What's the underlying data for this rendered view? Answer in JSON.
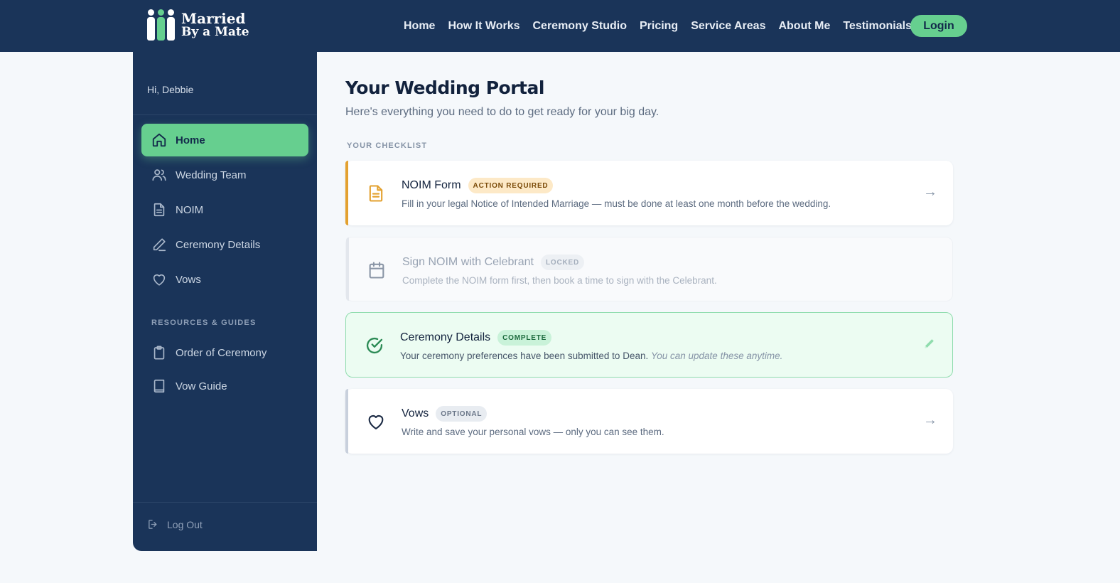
{
  "brand": {
    "line1": "Married",
    "line2": "By a Mate"
  },
  "nav": {
    "links": [
      "Home",
      "How It Works",
      "Ceremony Studio",
      "Pricing",
      "Service Areas",
      "About Me",
      "Testimonials"
    ],
    "login": "Login"
  },
  "sidebar": {
    "greeting": "Hi, Debbie",
    "items": [
      {
        "label": "Home",
        "icon": "home-icon"
      },
      {
        "label": "Wedding Team",
        "icon": "users-icon"
      },
      {
        "label": "NOIM",
        "icon": "document-icon"
      },
      {
        "label": "Ceremony Details",
        "icon": "pen-icon"
      },
      {
        "label": "Vows",
        "icon": "heart-icon"
      }
    ],
    "section_label": "RESOURCES & GUIDES",
    "resources": [
      {
        "label": "Order of Ceremony",
        "icon": "clipboard-icon"
      },
      {
        "label": "Vow Guide",
        "icon": "book-icon"
      }
    ],
    "logout": "Log Out"
  },
  "main": {
    "title": "Your Wedding Portal",
    "subtitle": "Here's everything you need to do to get ready for your big day.",
    "section_label": "YOUR CHECKLIST",
    "cards": [
      {
        "title": "NOIM Form",
        "badge": "ACTION REQUIRED",
        "desc": "Fill in your legal Notice of Intended Marriage — must be done at least one month before the wedding.",
        "icon": "document-icon",
        "status": "action"
      },
      {
        "title": "Sign NOIM with Celebrant",
        "badge": "LOCKED",
        "desc": "Complete the NOIM form first, then book a time to sign with the Celebrant.",
        "icon": "calendar-icon",
        "status": "locked"
      },
      {
        "title": "Ceremony Details",
        "badge": "COMPLETE",
        "desc": "Your ceremony preferences have been submitted to Dean.",
        "desc_note": "You can update these anytime.",
        "icon": "check-circle-icon",
        "status": "complete"
      },
      {
        "title": "Vows",
        "badge": "OPTIONAL",
        "desc": "Write and save your personal vows — only you can see them.",
        "icon": "heart-icon",
        "status": "optional"
      }
    ],
    "arrow": "→"
  },
  "colors": {
    "navy": "#1a3459",
    "green": "#66cf8f",
    "amber": "#e3a12f",
    "complete_bg": "#ecfcf2"
  }
}
